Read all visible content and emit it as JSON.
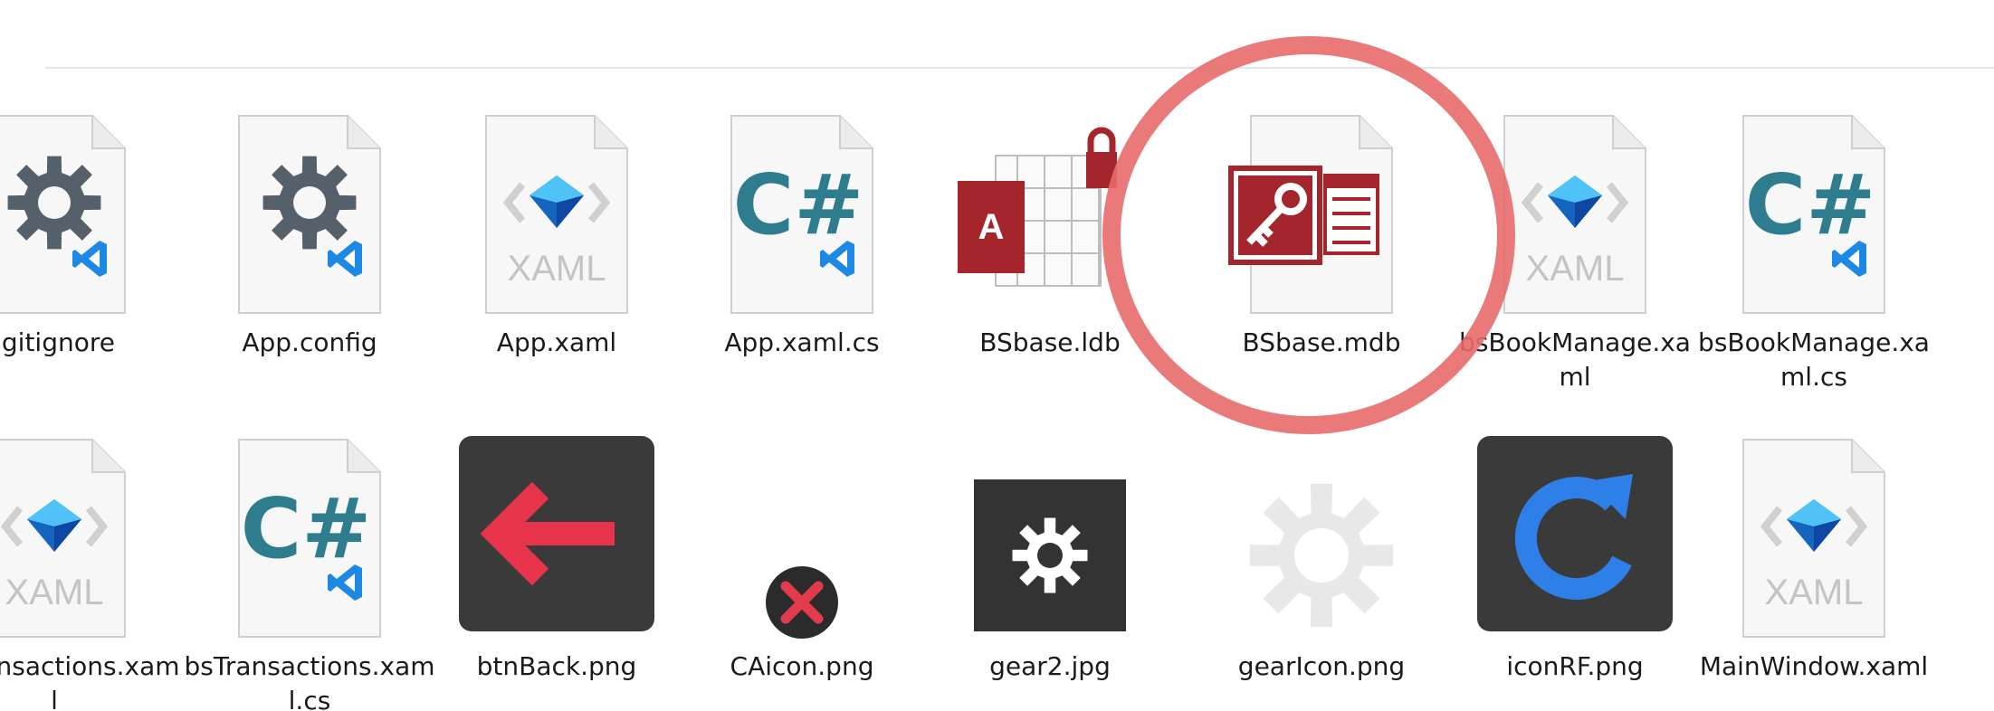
{
  "files": [
    {
      "row": 0,
      "col": 0,
      "name": "ignore",
      "label": ".gitignore",
      "icon": "vscode-gear-file-icon"
    },
    {
      "row": 0,
      "col": 1,
      "name": "app-config",
      "label": "App.config",
      "icon": "vscode-gear-file-icon"
    },
    {
      "row": 0,
      "col": 2,
      "name": "app-xaml",
      "label": "App.xaml",
      "icon": "xaml-file-icon"
    },
    {
      "row": 0,
      "col": 3,
      "name": "app-xaml-cs",
      "label": "App.xaml.cs",
      "icon": "csharp-file-icon"
    },
    {
      "row": 0,
      "col": 4,
      "name": "bsbase-ldb",
      "label": "BSbase.ldb",
      "icon": "access-lock-file-icon"
    },
    {
      "row": 0,
      "col": 5,
      "name": "bsbase-mdb",
      "label": "BSbase.mdb",
      "icon": "access-database-icon"
    },
    {
      "row": 0,
      "col": 6,
      "name": "bsbookmanage-xaml",
      "label": "bsBookManage.xaml",
      "icon": "xaml-file-icon"
    },
    {
      "row": 0,
      "col": 7,
      "name": "bsbookmanage-xaml-cs",
      "label": "bsBookManage.xaml.cs",
      "icon": "csharp-file-icon"
    },
    {
      "row": 1,
      "col": 0,
      "name": "bstransactions-xaml",
      "label": "bsTransactions.xaml",
      "icon": "xaml-file-icon"
    },
    {
      "row": 1,
      "col": 1,
      "name": "bstransactions-xaml-cs",
      "label": "bsTransactions.xaml.cs",
      "icon": "csharp-file-icon"
    },
    {
      "row": 1,
      "col": 2,
      "name": "btnback-png",
      "label": "btnBack.png",
      "icon": "back-arrow-image-icon"
    },
    {
      "row": 1,
      "col": 3,
      "name": "caicon-png",
      "label": "CAicon.png",
      "icon": "red-x-image-icon"
    },
    {
      "row": 1,
      "col": 4,
      "name": "gear2-jpg",
      "label": "gear2.jpg",
      "icon": "dark-gear-image-icon"
    },
    {
      "row": 1,
      "col": 5,
      "name": "gearicon-png",
      "label": "gearIcon.png",
      "icon": "light-gear-image-icon"
    },
    {
      "row": 1,
      "col": 6,
      "name": "iconrf-png",
      "label": "iconRF.png",
      "icon": "refresh-image-icon"
    },
    {
      "row": 1,
      "col": 7,
      "name": "mainwindow-xaml",
      "label": "MainWindow.xaml",
      "icon": "xaml-file-icon"
    }
  ],
  "icon_text": {
    "xaml": "XAML",
    "csharp": "C#",
    "access": "A"
  },
  "colors": {
    "highlight": "#e86c6c",
    "csharp_teal": "#2e7d8e",
    "vscode_blue": "#1e88e5",
    "access_red": "#a4262c",
    "dark_tile": "#3a3a3a",
    "back_red": "#e8344a",
    "refresh_blue": "#2f7fe8"
  }
}
